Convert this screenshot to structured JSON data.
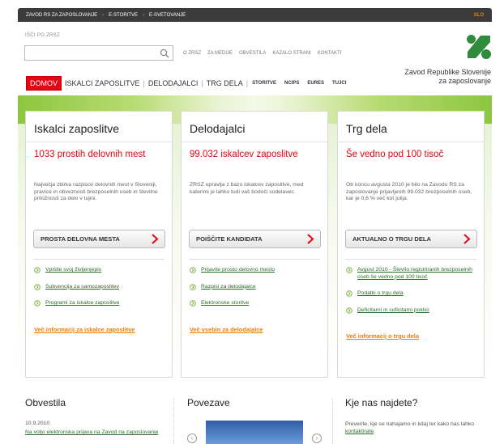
{
  "topbar": {
    "links": [
      "ZAVOD RS ZA ZAPOSLOVANJE",
      "E-STORITVE",
      "E-SVETOVANJE"
    ],
    "separator": "›",
    "language": "SLO"
  },
  "search": {
    "label": "IŠČI PO ZRSZ",
    "value": "",
    "placeholder": ""
  },
  "top_links": [
    "O ZRSZ",
    "ZA MEDIJE",
    "OBVESTILA",
    "KAZALO STRANI",
    "KONTAKTI"
  ],
  "org_name": [
    "Zavod Republike Slovenije",
    "za zaposlovanje"
  ],
  "main_nav": {
    "home": "DOMOV",
    "items": [
      "ISKALCI ZAPOSLITVE",
      "DELODAJALCI",
      "TRG DELA"
    ],
    "small_items": [
      "STORITVE",
      "NCIPS",
      "EURES",
      "TUJCI"
    ]
  },
  "cards": [
    {
      "title": "Iskalci zaposlitve",
      "headline": "1033 prostih delovnih mest",
      "description": "Največja zbirka razpisov delovnih mest v Sloveniji, pravice in obveznosti brezposelnih oseb in številne priložnosti za delo v tujini.",
      "cta": "PROSTA DELOVNA MESTA",
      "links": [
        "Vpišite svoj življenjepis",
        "Subvencija za samozaposlitev",
        "Programi za iskalce zaposlitve"
      ],
      "more": "Več informacij za iskalce zaposlitve"
    },
    {
      "title": "Delodajalci",
      "headline": "99.032 iskalcev zaposlitve",
      "description": "ZRSZ upravlja z bazo iskalcev zaposlitve, med katerimi je lahko tudi vaš bodoči sodelavec.",
      "cta": "POIŠČITE KANDIDATA",
      "links": [
        "Prijavite prosto delovno mesto",
        "Razpisi za delodajalce",
        "Elektronske storitve"
      ],
      "more": "Več vsebin za delodajalce"
    },
    {
      "title": "Trg dela",
      "headline": "Še vedno pod 100 tisoč",
      "description": "Ob koncu avgusta 2010 je bilo na Zavodu RS za zaposlovanje prijavljenih 99.032 brezposelnih oseb, kar je 0,6 % več kot julija.",
      "cta": "AKTUALNO O TRGU DELA",
      "links": [
        "Avgust 2010 - Število registriranih brezposelnih oseb še vedno pod 100 tisoč",
        "Podatki o trgu dela",
        "Deficitarni in suficitarni poklici"
      ],
      "more": "Več informacij o trgu dela"
    }
  ],
  "bottom": {
    "news": {
      "title": "Obvestila",
      "date": "10.9.2010",
      "link": "Na voljo elektronska prijava na Zavod na zaposlovanje"
    },
    "links": {
      "title": "Povezave",
      "prev": "‹",
      "next": "›"
    },
    "find": {
      "title": "Kje nas najdete?",
      "text": "Preverite, kje se nahajamo in kdaj ter kako nas lahko ",
      "link": "kontaktirate",
      "end": "."
    }
  },
  "colors": {
    "accent_red": "#e30613",
    "accent_green": "#7ab341",
    "accent_orange": "#f07d00",
    "link_green": "#2a6e2a"
  },
  "icons": {
    "search": "search-icon",
    "logo": "zrsz-logo",
    "arrow": "chevron-right-icon",
    "bullet": "circle-arrow-icon"
  }
}
